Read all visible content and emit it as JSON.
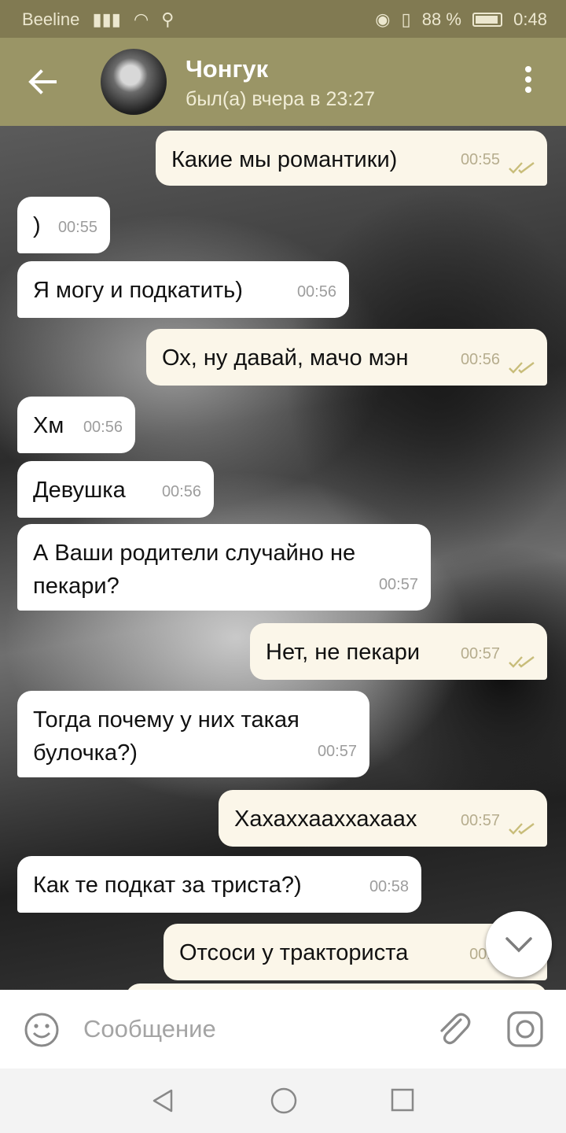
{
  "status_bar": {
    "carrier": "Beeline",
    "battery": "88 %",
    "time": "0:48"
  },
  "header": {
    "contact_name": "Чонгук",
    "last_seen": "был(а) вчера в 23:27"
  },
  "messages": [
    {
      "direction": "out",
      "text": "Какие мы романтики)",
      "time": "00:55",
      "read": true
    },
    {
      "direction": "in",
      "text": ")",
      "time": "00:55"
    },
    {
      "direction": "in",
      "text": "Я могу и подкатить)",
      "time": "00:56"
    },
    {
      "direction": "out",
      "text": "Ох, ну давай, мачо мэн",
      "time": "00:56",
      "read": true
    },
    {
      "direction": "in",
      "text": "Хм",
      "time": "00:56"
    },
    {
      "direction": "in",
      "text": "Девушка",
      "time": "00:56"
    },
    {
      "direction": "in",
      "text_lines": [
        "А Ваши родители случайно не",
        "пекари?"
      ],
      "time": "00:57"
    },
    {
      "direction": "out",
      "text": "Нет, не пекари",
      "time": "00:57",
      "read": true
    },
    {
      "direction": "in",
      "text_lines": [
        "Тогда почему у них такая",
        "булочка?)"
      ],
      "time": "00:57"
    },
    {
      "direction": "out",
      "text": "Хахаххааххахаах",
      "time": "00:57",
      "read": true
    },
    {
      "direction": "in",
      "text": "Как те подкат за триста?)",
      "time": "00:58"
    },
    {
      "direction": "out",
      "text": "Отсоси у тракториста",
      "time": "00:5"
    }
  ],
  "input": {
    "placeholder": "Сообщение"
  },
  "colors": {
    "header": "#9a9566",
    "status_bar": "#817a52",
    "outgoing_bubble": "#fbf6e9",
    "incoming_bubble": "#ffffff",
    "read_check": "#c8bd7a"
  },
  "icons": [
    "back-arrow-icon",
    "more-vert-icon",
    "double-check-icon",
    "chevron-down-icon",
    "emoji-icon",
    "attach-icon",
    "camera-icon",
    "nav-back-icon",
    "nav-home-icon",
    "nav-recent-icon"
  ]
}
